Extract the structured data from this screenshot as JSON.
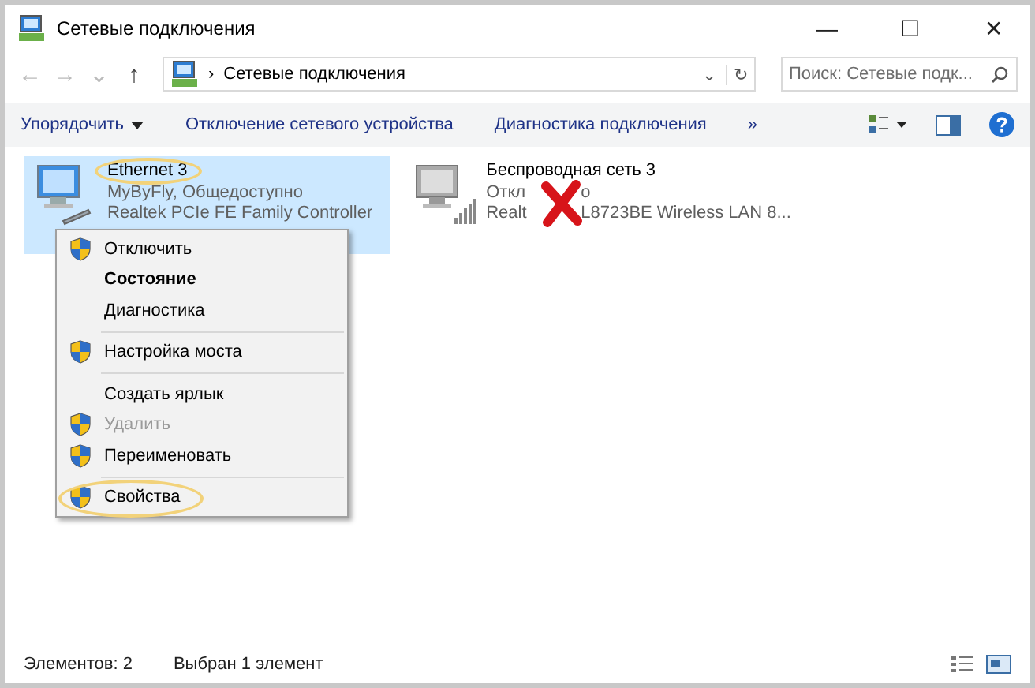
{
  "window": {
    "title": "Сетевые подключения",
    "controls": [
      "—",
      "☐",
      "✕"
    ]
  },
  "address_bar": {
    "back": "←",
    "forward": "→",
    "recent": "⌄",
    "up": "↑",
    "separator": "›",
    "path": "Сетевые подключения",
    "dropdown": "⌄",
    "refresh": "↻",
    "search": {
      "placeholder": "Поиск: Сетевые подк..."
    }
  },
  "command_bar": {
    "items": [
      {
        "label": "Упорядочить",
        "dropdown": true
      },
      {
        "label": "Отключение сетевого устройства",
        "dropdown": false
      },
      {
        "label": "Диагностика подключения",
        "dropdown": false
      },
      {
        "label": "»",
        "dropdown": false
      }
    ]
  },
  "connections": [
    {
      "kind": "wired",
      "name": "Ethernet 3",
      "status_parts": [
        "MyByFly, Общедоступно"
      ],
      "adapter_parts": [
        "Realtek PCIe FE Family Controller"
      ],
      "selected": true,
      "annotated": true,
      "disconnected": false
    },
    {
      "kind": "wireless",
      "name": "Беспроводная сеть 3",
      "status_parts": [
        "Откл",
        "о"
      ],
      "adapter_parts": [
        "Realt",
        "L8723BE Wireless LAN 8..."
      ],
      "selected": false,
      "annotated": false,
      "disconnected": true
    }
  ],
  "context_menu": [
    {
      "kind": "item",
      "label": "Отключить",
      "shield": true,
      "bold": false,
      "disabled": false,
      "annotated": false
    },
    {
      "kind": "item",
      "label": "Состояние",
      "shield": false,
      "bold": true,
      "disabled": false,
      "annotated": false
    },
    {
      "kind": "item",
      "label": "Диагностика",
      "shield": false,
      "bold": false,
      "disabled": false,
      "annotated": false
    },
    {
      "kind": "separator"
    },
    {
      "kind": "item",
      "label": "Настройка моста",
      "shield": true,
      "bold": false,
      "disabled": false,
      "annotated": false
    },
    {
      "kind": "separator"
    },
    {
      "kind": "item",
      "label": "Создать ярлык",
      "shield": false,
      "bold": false,
      "disabled": false,
      "annotated": false
    },
    {
      "kind": "item",
      "label": "Удалить",
      "shield": true,
      "bold": false,
      "disabled": true,
      "annotated": false
    },
    {
      "kind": "item",
      "label": "Переименовать",
      "shield": true,
      "bold": false,
      "disabled": false,
      "annotated": false
    },
    {
      "kind": "separator"
    },
    {
      "kind": "item",
      "label": "Свойства",
      "shield": true,
      "bold": false,
      "disabled": false,
      "annotated": true
    }
  ],
  "status_bar": {
    "count": "Элементов: 2",
    "selection": "Выбран 1 элемент"
  }
}
